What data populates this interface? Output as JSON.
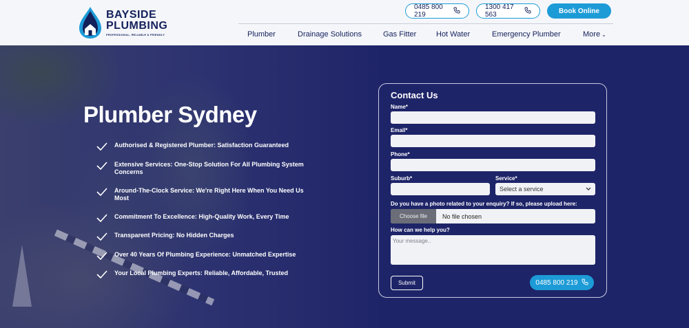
{
  "header": {
    "logo": {
      "line1": "BAYSIDE",
      "line2": "PLUMBING",
      "tagline": "PROFESSIONAL, RELIABLE & FRIENDLY"
    },
    "phone1": "0485 800 219",
    "phone2": "1300 417 563",
    "book_label": "Book Online",
    "nav": [
      {
        "label": "Plumber"
      },
      {
        "label": "Drainage Solutions"
      },
      {
        "label": "Gas Fitter"
      },
      {
        "label": "Hot Water"
      },
      {
        "label": "Emergency Plumber"
      },
      {
        "label": "More"
      }
    ]
  },
  "hero": {
    "title": "Plumber Sydney",
    "features": [
      "Authorised & Registered Plumber: Satisfaction Guaranteed",
      "Extensive Services: One-Stop Solution For All Plumbing System Concerns",
      "Around-The-Clock Service: We're Right Here When You Need Us Most",
      "Commitment To Excellence: High-Quality Work, Every Time",
      "Transparent Pricing: No Hidden Charges",
      "Over 40 Years Of Plumbing Experience: Unmatched Expertise",
      "Your Local Plumbing Experts: Reliable, Affordable, Trusted"
    ]
  },
  "contact": {
    "title": "Contact Us",
    "name_label": "Name*",
    "email_label": "Email*",
    "phone_label": "Phone*",
    "suburb_label": "Suburb*",
    "service_label": "Service*",
    "service_value": "Select a service",
    "upload_label": "Do you have a photo related to your enquiry? If so, please upload here:",
    "file_button": "Choose file",
    "file_status": "No file chosen",
    "message_label": "How can we help you?",
    "message_placeholder": "Your message..",
    "submit_label": "Submit",
    "call_label": "0485 800 219"
  },
  "colors": {
    "navy": "#1e2468",
    "accent": "#1d9bd7",
    "header_bg": "#f4f6fa",
    "text_dark": "#14205a"
  }
}
